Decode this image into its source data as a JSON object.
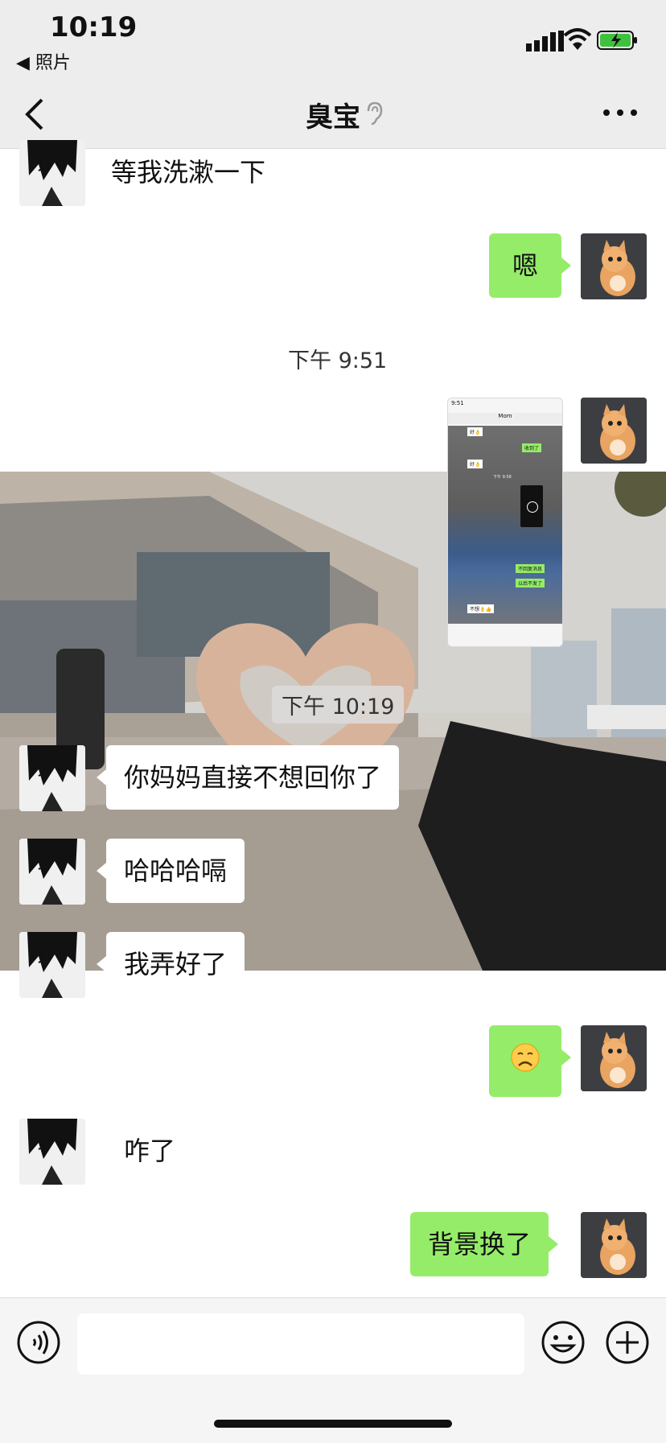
{
  "status_bar": {
    "time": "10:19",
    "back_app": "◀ 照片"
  },
  "nav": {
    "title": "臭宝"
  },
  "messages": [
    {
      "side": "left",
      "text": "等我洗漱一下"
    },
    {
      "side": "right",
      "text": "嗯"
    },
    {
      "timestamp": "下午 9:51"
    },
    {
      "side": "right",
      "type": "image",
      "description": "screenshot"
    },
    {
      "timestamp": "下午 10:19"
    },
    {
      "side": "left",
      "text": "你妈妈直接不想回你了"
    },
    {
      "side": "left",
      "text": "哈哈哈嗝"
    },
    {
      "side": "left",
      "text": "我弄好了"
    },
    {
      "side": "right",
      "text": "😞"
    },
    {
      "side": "left",
      "text": "咋了"
    },
    {
      "side": "right",
      "text": "背景换了"
    }
  ],
  "thumbnail": {
    "time": "9:51",
    "title": "Mom",
    "rows": [
      "好👌",
      "收到了",
      "好👌",
      "下午 9:58",
      "不回复消息",
      "以后不发了",
      "不想👌👍"
    ]
  },
  "input": {
    "placeholder": ""
  },
  "colors": {
    "bar_bg": "#ededed",
    "green_bubble": "#95ec69",
    "white_bubble": "#ffffff"
  }
}
